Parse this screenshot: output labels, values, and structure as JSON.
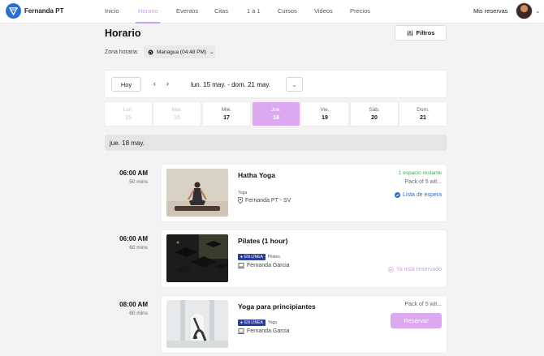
{
  "app": {
    "brand": "Fernanda PT",
    "nav": [
      "Inicio",
      "Horario",
      "Eventos",
      "Citas",
      "1 a 1",
      "Cursos",
      "Videos",
      "Precios"
    ],
    "active_nav": "Horario",
    "account_link": "Mis reservas",
    "accent": "#dca8ef",
    "brand_color": "#2a6fd6"
  },
  "header": {
    "title": "Horario",
    "filters_label": "Filtros",
    "timezone_label": "Zona horaria:",
    "timezone_value": "Managua (04:48 PM)"
  },
  "week": {
    "today_label": "Hoy",
    "range": "lun. 15 may. - dom. 21 may.",
    "days": [
      {
        "name": "Lun.",
        "date": "15",
        "state": "past"
      },
      {
        "name": "Mar.",
        "date": "16",
        "state": "past"
      },
      {
        "name": "Mié.",
        "date": "17",
        "state": "normal"
      },
      {
        "name": "Jue.",
        "date": "18",
        "state": "active"
      },
      {
        "name": "Vie.",
        "date": "19",
        "state": "normal"
      },
      {
        "name": "Sáb.",
        "date": "20",
        "state": "normal"
      },
      {
        "name": "Dom.",
        "date": "21",
        "state": "normal"
      }
    ]
  },
  "selected_date": "jue. 18 may.",
  "classes": [
    {
      "time": "06:00 AM",
      "duration": "50 mins",
      "title": "Hatha Yoga",
      "category": "Yoga",
      "instructor": "Fernanda PT - SV",
      "availability": "1 espacio restante",
      "pack": "Pack of 5 wit...",
      "action": "Lista de espera"
    },
    {
      "time": "06:00 AM",
      "duration": "60 mins",
      "title": "Pilates (1 hour)",
      "online_badge": "EN LÍNEA",
      "category": "Pilates",
      "instructor": "Fernanda Garcia",
      "status": "Ya está reservado"
    },
    {
      "time": "08:00 AM",
      "duration": "60 mins",
      "title": "Yoga para principiantes",
      "online_badge": "EN LÍNEA",
      "category": "Yoga",
      "instructor": "Fernanda Garcia",
      "pack": "Pack of 5 wit...",
      "action": "Reservar"
    }
  ]
}
